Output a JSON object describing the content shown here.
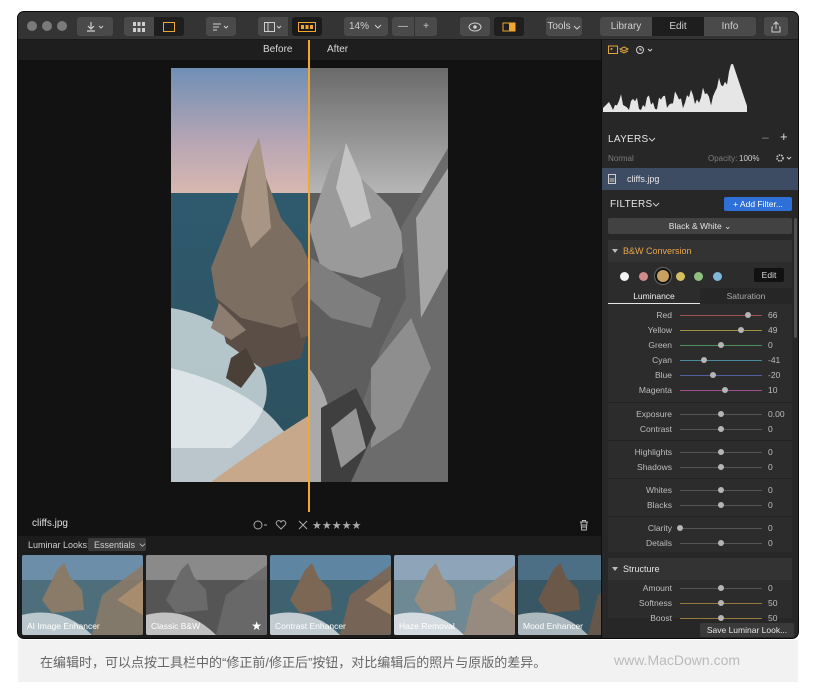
{
  "toolbar": {
    "zoom": "14%",
    "tools_label": "Tools",
    "tabs": [
      {
        "label": "Library",
        "active": false
      },
      {
        "label": "Edit",
        "active": true
      },
      {
        "label": "Info",
        "active": false
      }
    ]
  },
  "compare": {
    "before": "Before",
    "after": "After"
  },
  "image": {
    "filename": "cliffs.jpg",
    "stars": "★★★★★"
  },
  "looks": {
    "label": "Luminar Looks:",
    "category": "Essentials",
    "items": [
      {
        "name": "AI Image Enhancer"
      },
      {
        "name": "Classic B&W"
      },
      {
        "name": "Contrast Enhancer"
      },
      {
        "name": "Haze Removal"
      },
      {
        "name": "Mood Enhancer"
      }
    ]
  },
  "layers": {
    "title": "LAYERS",
    "blend": "Normal",
    "opacity_label": "Opacity:",
    "opacity": "100%",
    "layer_name": "cliffs.jpg"
  },
  "filters": {
    "title": "FILTERS",
    "add_button": "+ Add Filter...",
    "preset": "Black & White",
    "bw": {
      "title": "B&W Conversion",
      "edit_label": "Edit",
      "swatches": [
        "#f2f2f2",
        "#d28a8a",
        "#c8a060",
        "#d4c060",
        "#90c080",
        "#80b8d8"
      ],
      "tab_luminance": "Luminance",
      "tab_saturation": "Saturation",
      "colors": [
        {
          "label": "Red",
          "value": "66",
          "pos": 0.83
        },
        {
          "label": "Yellow",
          "value": "49",
          "pos": 0.745
        },
        {
          "label": "Green",
          "value": "0",
          "pos": 0.5
        },
        {
          "label": "Cyan",
          "value": "-41",
          "pos": 0.295
        },
        {
          "label": "Blue",
          "value": "-20",
          "pos": 0.4
        },
        {
          "label": "Magenta",
          "value": "10",
          "pos": 0.55
        }
      ],
      "tone": [
        {
          "label": "Exposure",
          "value": "0.00",
          "pos": 0.5
        },
        {
          "label": "Contrast",
          "value": "0",
          "pos": 0.5
        }
      ],
      "light": [
        {
          "label": "Highlights",
          "value": "0",
          "pos": 0.5
        },
        {
          "label": "Shadows",
          "value": "0",
          "pos": 0.5
        }
      ],
      "points": [
        {
          "label": "Whites",
          "value": "0",
          "pos": 0.5
        },
        {
          "label": "Blacks",
          "value": "0",
          "pos": 0.5
        }
      ],
      "detail": [
        {
          "label": "Clarity",
          "value": "0",
          "pos": 0.0
        },
        {
          "label": "Details",
          "value": "0",
          "pos": 0.5
        }
      ]
    },
    "structure": {
      "title": "Structure",
      "rows": [
        {
          "label": "Amount",
          "value": "0",
          "pos": 0.5
        },
        {
          "label": "Softness",
          "value": "50",
          "pos": 0.5
        },
        {
          "label": "Boost",
          "value": "50",
          "pos": 0.5
        }
      ]
    },
    "save_look": "Save Luminar Look..."
  },
  "caption": {
    "text": "在编辑时，可以点按工具栏中的“修正前/修正后”按钮，对比编辑后的照片与原版的差异。",
    "watermark": "www.MacDown.com"
  },
  "colors": {
    "accent": "#f0a830",
    "add_button": "#2f6fd8",
    "bw_title": "#e8a84a"
  }
}
